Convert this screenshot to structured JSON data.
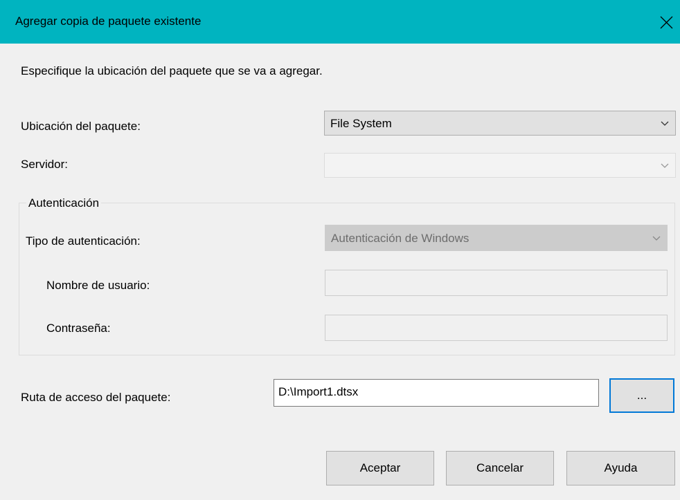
{
  "window": {
    "title": "Agregar copia de paquete existente",
    "close_icon": "close-icon"
  },
  "intro": "Especifique la ubicación del paquete que se va a agregar.",
  "package_location": {
    "label": "Ubicación del paquete:",
    "value": "File System"
  },
  "server": {
    "label": "Servidor:",
    "value": ""
  },
  "authentication": {
    "group_label": "Autenticación",
    "type_label": "Tipo de autenticación:",
    "type_value": "Autenticación de Windows",
    "username_label": "Nombre de usuario:",
    "username_value": "",
    "password_label": "Contraseña:",
    "password_value": ""
  },
  "package_path": {
    "label": "Ruta de acceso del paquete:",
    "value": "D:\\Import1.dtsx",
    "browse_label": "..."
  },
  "buttons": {
    "ok": "Aceptar",
    "cancel": "Cancelar",
    "help": "Ayuda"
  },
  "colors": {
    "titlebar": "#00b4c0",
    "focus": "#0078d7"
  }
}
